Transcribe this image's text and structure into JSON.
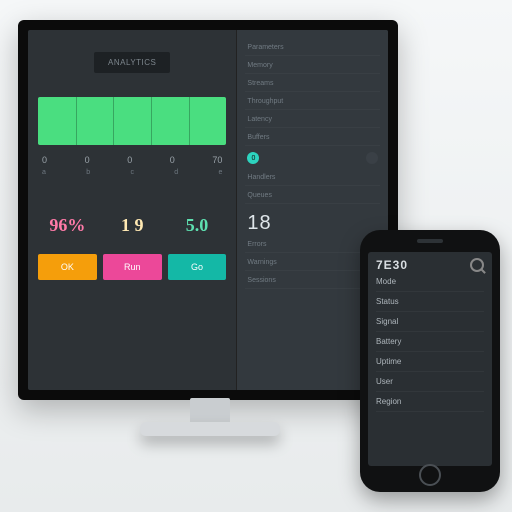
{
  "monitor": {
    "header": "ANALYTICS",
    "axis": [
      "0",
      "0",
      "0",
      "0",
      "70"
    ],
    "miniAxis": [
      "a",
      "b",
      "c",
      "d",
      "e"
    ],
    "metrics": [
      {
        "value": "96%",
        "color": "#ff7aa8"
      },
      {
        "value": "1 9",
        "color": "#ffe9b3"
      },
      {
        "value": "5.0",
        "color": "#5ee0b0"
      }
    ],
    "buttons": [
      {
        "label": "OK",
        "color": "#f59e0b"
      },
      {
        "label": "Run",
        "color": "#ec4899"
      },
      {
        "label": "Go",
        "color": "#14b8a6"
      }
    ],
    "segments": [
      20,
      40,
      60,
      80
    ]
  },
  "side": {
    "title": "Parameters",
    "rows": [
      {
        "label": "Memory",
        "value": ""
      },
      {
        "label": "Streams",
        "value": ""
      },
      {
        "label": "Throughput",
        "value": ""
      },
      {
        "label": "Latency",
        "value": ""
      },
      {
        "label": "Buffers",
        "value": ""
      },
      {
        "label": "Handlers",
        "value": ""
      },
      {
        "label": "Queues",
        "value": ""
      }
    ],
    "dotA": {
      "label": "0",
      "color": "#2dd4bf"
    },
    "dotB": {
      "label": "",
      "color": "#3a4046"
    },
    "big": "18",
    "rows2": [
      {
        "label": "Errors",
        "value": ""
      },
      {
        "label": "Warnings",
        "value": ""
      },
      {
        "label": "Sessions",
        "value": ""
      }
    ]
  },
  "phone": {
    "title": "7E30",
    "rows": [
      {
        "label": "Mode",
        "value": ""
      },
      {
        "label": "Status",
        "value": ""
      },
      {
        "label": "Signal",
        "value": ""
      },
      {
        "label": "Battery",
        "value": ""
      },
      {
        "label": "Uptime",
        "value": ""
      },
      {
        "label": "User",
        "value": ""
      },
      {
        "label": "Region",
        "value": ""
      }
    ]
  }
}
